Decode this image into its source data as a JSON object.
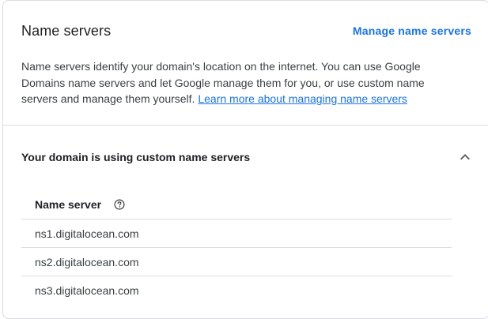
{
  "card": {
    "title": "Name servers",
    "manage_link": "Manage name servers",
    "description": "Name servers identify your domain's location on the internet. You can use Google Domains name servers and let Google manage them for you, or use custom name servers and manage them yourself.",
    "learn_more_link": "Learn more about managing name servers"
  },
  "section": {
    "title": "Your domain is using custom name servers",
    "collapse_icon": "chevron-up-icon"
  },
  "table": {
    "header": "Name server",
    "help_icon": "help-circle-icon",
    "rows": [
      "ns1.digitalocean.com",
      "ns2.digitalocean.com",
      "ns3.digitalocean.com"
    ]
  },
  "colors": {
    "link": "#1a73e8",
    "text": "#202124",
    "divider": "#dadce0"
  }
}
